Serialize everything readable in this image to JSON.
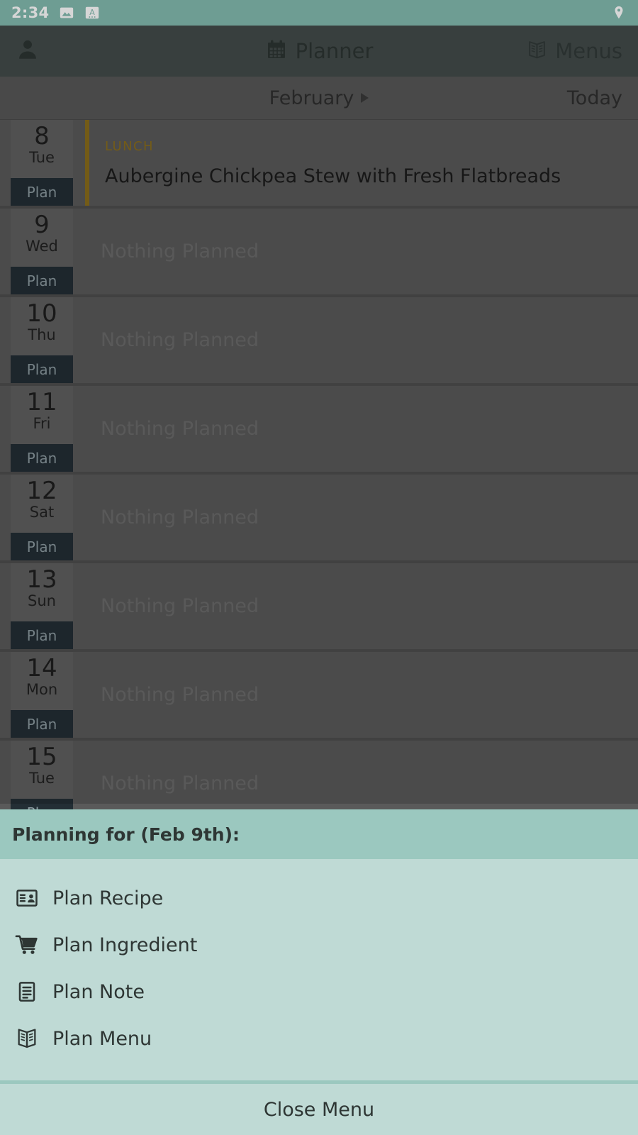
{
  "status_bar": {
    "time": "2:34",
    "icons_left": [
      "image-icon",
      "font-size-icon"
    ],
    "icons_right": [
      "location-pin-icon"
    ],
    "bg_color": "#84bbb0"
  },
  "header": {
    "profile_icon": "person-icon",
    "title": "Planner",
    "title_icon": "calendar-icon",
    "menus_label": "Menus",
    "menus_icon": "open-book-icon",
    "bg_color": "#434c4a"
  },
  "month_bar": {
    "month": "February",
    "arrow_icon": "chevron-right-icon",
    "today_label": "Today",
    "bg_color": "#585858"
  },
  "planner": {
    "plan_button_label": "Plan",
    "empty_text": "Nothing Planned",
    "accent_color": "#8a6d1c",
    "days": [
      {
        "num": "8",
        "weekday": "Tue",
        "meal_label": "LUNCH",
        "meal_title": "Aubergine Chickpea Stew with Fresh Flatbreads",
        "planned": true
      },
      {
        "num": "9",
        "weekday": "Wed",
        "meal_label": "",
        "meal_title": "",
        "planned": false
      },
      {
        "num": "10",
        "weekday": "Thu",
        "meal_label": "",
        "meal_title": "",
        "planned": false
      },
      {
        "num": "11",
        "weekday": "Fri",
        "meal_label": "",
        "meal_title": "",
        "planned": false
      },
      {
        "num": "12",
        "weekday": "Sat",
        "meal_label": "",
        "meal_title": "",
        "planned": false
      },
      {
        "num": "13",
        "weekday": "Sun",
        "meal_label": "",
        "meal_title": "",
        "planned": false
      },
      {
        "num": "14",
        "weekday": "Mon",
        "meal_label": "",
        "meal_title": "",
        "planned": false
      },
      {
        "num": "15",
        "weekday": "Tue",
        "meal_label": "",
        "meal_title": "",
        "planned": false
      }
    ]
  },
  "bottom_sheet": {
    "header_title": "Planning for (Feb 9th):",
    "header_bg": "#9bc8bf",
    "body_bg": "#bfdad5",
    "items": [
      {
        "label": "Plan Recipe",
        "icon": "recipe-card-icon"
      },
      {
        "label": "Plan Ingredient",
        "icon": "shopping-cart-icon"
      },
      {
        "label": "Plan Note",
        "icon": "note-document-icon"
      },
      {
        "label": "Plan Menu",
        "icon": "open-book-icon"
      }
    ],
    "close_label": "Close Menu"
  }
}
